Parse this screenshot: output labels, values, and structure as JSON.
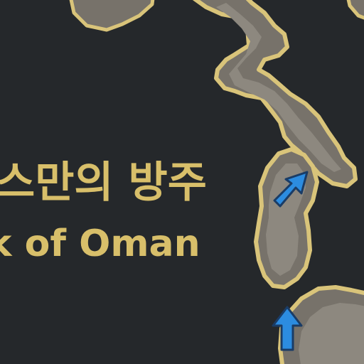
{
  "map": {
    "colors": {
      "background": "#25282b",
      "land": "#77726a",
      "land_inner": "#8d887f",
      "border": "#d9c47a",
      "label": "#d8bf6a",
      "arrow": "#2c8ce0"
    },
    "region_label": {
      "korean": "스만의 방주",
      "english": "k of Oman"
    },
    "icons": [
      "arrow-icon",
      "arrow-icon"
    ]
  }
}
